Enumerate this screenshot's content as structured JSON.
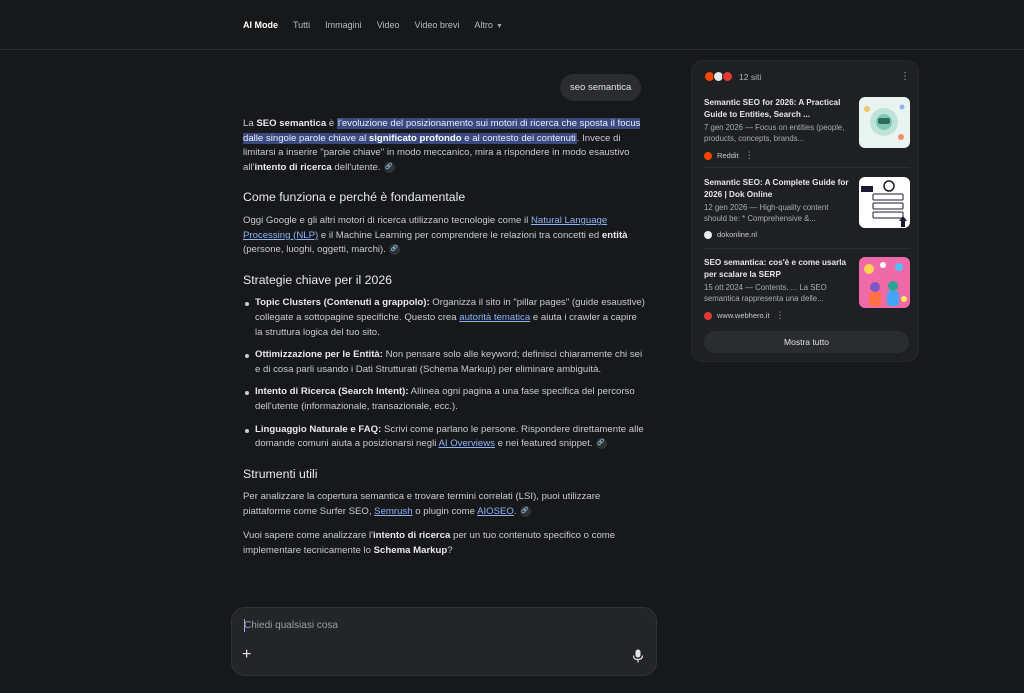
{
  "nav": {
    "tabs": [
      {
        "label": "AI Mode",
        "active": true
      },
      {
        "label": "Tutti"
      },
      {
        "label": "Immagini"
      },
      {
        "label": "Video"
      },
      {
        "label": "Video brevi"
      },
      {
        "label": "Altro"
      }
    ]
  },
  "query": "seo semantica",
  "answer": {
    "intro": {
      "t1": "La ",
      "b1": "SEO semantica",
      "t2": " è ",
      "hl1": "l'evoluzione del posizionamento sui motori di ricerca che sposta il focus dalle singole parole chiave al ",
      "hlb": "significato profondo",
      "hl2": " e al contesto dei contenuti",
      "t3": ". Invece di limitarsi a inserire \"parole chiave\" in modo meccanico, mira a rispondere in modo esaustivo all'",
      "b2": "intento di ricerca",
      "t4": " dell'utente."
    },
    "h_funziona": "Come funziona e perché è fondamentale",
    "funziona": {
      "t1": "Oggi Google e gli altri motori di ricerca utilizzano tecnologie come il ",
      "link": "Natural Language Processing (NLP)",
      "t2": " e il Machine Learning per comprendere le relazioni tra concetti ed ",
      "b1": "entità",
      "t3": " (persone, luoghi, oggetti, marchi)."
    },
    "h_strategie": "Strategie chiave per il 2026",
    "strategie": [
      {
        "bold": "Topic Clusters (Contenuti a grappolo):",
        "text": " Organizza il sito in \"pillar pages\" (guide esaustive) collegate a sottopagine specifiche. Questo crea ",
        "link": "autorità tematica",
        "text2": " e aiuta i crawler a capire la struttura logica del tuo sito."
      },
      {
        "bold": "Ottimizzazione per le Entità:",
        "text": " Non pensare solo alle keyword; definisci chiaramente chi sei e di cosa parli usando i Dati Strutturati (Schema Markup) per eliminare ambiguità."
      },
      {
        "bold": "Intento di Ricerca (Search Intent):",
        "text": " Allinea ogni pagina a una fase specifica del percorso dell'utente (informazionale, transazionale, ecc.)."
      },
      {
        "bold": "Linguaggio Naturale e FAQ:",
        "text": " Scrivi come parlano le persone. Rispondere direttamente alle domande comuni aiuta a posizionarsi negli ",
        "link": "AI Overviews",
        "text2": " e nei featured snippet."
      }
    ],
    "h_strumenti": "Strumenti utili",
    "strumenti": {
      "t1": "Per analizzare la copertura semantica e trovare termini correlati (LSI), puoi utilizzare piattaforme come Surfer SEO, ",
      "link1": "Semrush",
      "t2": " o plugin come ",
      "link2": "AIOSEO",
      "t3": "."
    },
    "closing": {
      "t1": "Vuoi sapere come analizzare l'",
      "b1": "intento di ricerca",
      "t2": " per un tuo contenuto specifico o come implementare tecnicamente lo ",
      "b2": "Schema Markup",
      "t3": "?"
    }
  },
  "input": {
    "placeholder": "Chiedi qualsiasi cosa",
    "plus": "+"
  },
  "sources": {
    "count": "12 siti",
    "items": [
      {
        "title": "Semantic SEO for 2026: A Practical Guide to Entities, Search ...",
        "snippet": "7 gen 2026 — Focus on entities (people, products, concepts, brands...",
        "site": "Reddit",
        "site_color": "#ff4500"
      },
      {
        "title": "Semantic SEO: A Complete Guide for 2026 | Dok Online",
        "snippet": "12 gen 2026 — High-quality content should be: * Comprehensive &...",
        "site": "dokonline.nl",
        "site_color": "#1a1a1a"
      },
      {
        "title": "SEO semantica: cos'è e come usarla per scalare la SERP",
        "snippet": "15 ott 2024 — Contents. ... La SEO semantica rappresenta una delle...",
        "site": "www.webhero.it",
        "site_color": "#e53935"
      }
    ],
    "show_all": "Mostra tutto"
  },
  "colors": {
    "background": "#17181a",
    "highlight": "#3b4a7e",
    "link": "#8ab4f8",
    "panel": "#1f2023"
  }
}
